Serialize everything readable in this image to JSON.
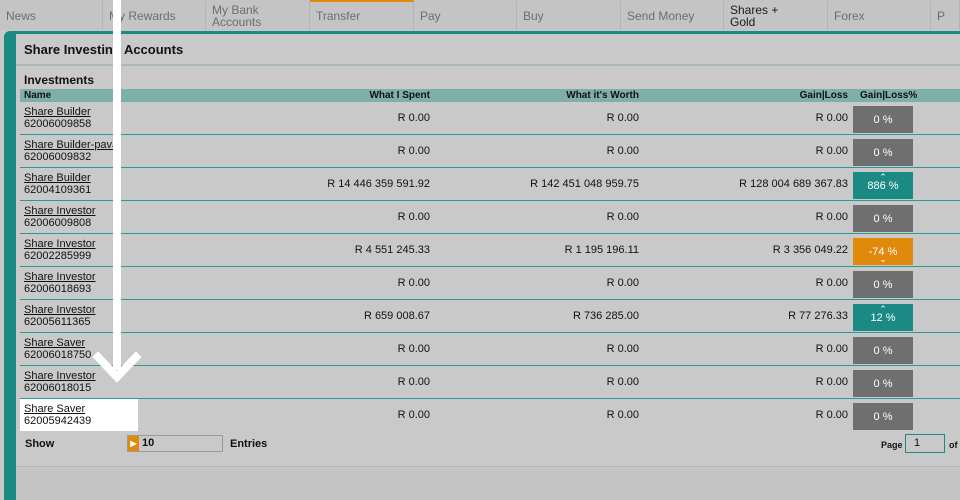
{
  "nav": {
    "items": [
      {
        "label": "News",
        "width": 103,
        "accent": false,
        "active": false
      },
      {
        "label": "My Rewards",
        "width": 103,
        "accent": false,
        "active": false
      },
      {
        "label": "My Bank\nAccounts",
        "width": 104,
        "accent": false,
        "active": false
      },
      {
        "label": "Transfer",
        "width": 104,
        "accent": true,
        "active": false
      },
      {
        "label": "Pay",
        "width": 103,
        "accent": false,
        "active": false
      },
      {
        "label": "Buy",
        "width": 104,
        "accent": false,
        "active": false
      },
      {
        "label": "Send Money",
        "width": 103,
        "accent": false,
        "active": false
      },
      {
        "label": "Shares +\nGold",
        "width": 104,
        "accent": false,
        "active": true
      },
      {
        "label": "Forex",
        "width": 103,
        "accent": false,
        "active": false
      },
      {
        "label": "P",
        "width": 29,
        "accent": false,
        "active": false
      }
    ]
  },
  "panel": {
    "title": "Share Investing Accounts",
    "section": "Investments"
  },
  "table": {
    "headers": {
      "name": "Name",
      "spent": "What I Spent",
      "worth": "What it's Worth",
      "gain": "Gain|Loss",
      "gain_pct": "Gain|Loss%"
    },
    "rows": [
      {
        "name": "Share Builder",
        "number": "62006009858",
        "spent": "R 0.00",
        "worth": "R 0.00",
        "gain": "R 0.00",
        "pct": "0 %",
        "trend": "neutral"
      },
      {
        "name": "Share Builder-pava",
        "number": "62006009832",
        "spent": "R 0.00",
        "worth": "R 0.00",
        "gain": "R 0.00",
        "pct": "0 %",
        "trend": "neutral"
      },
      {
        "name": "Share Builder",
        "number": "62004109361",
        "spent": "R 14 446 359 591.92",
        "worth": "R 142 451 048 959.75",
        "gain": "R 128 004 689 367.83",
        "pct": "886 %",
        "trend": "up"
      },
      {
        "name": "Share Investor",
        "number": "62006009808",
        "spent": "R 0.00",
        "worth": "R 0.00",
        "gain": "R 0.00",
        "pct": "0 %",
        "trend": "neutral"
      },
      {
        "name": "Share Investor",
        "number": "62002285999",
        "spent": "R 4 551 245.33",
        "worth": "R 1 195 196.11",
        "gain": "R 3 356 049.22",
        "pct": "-74 %",
        "trend": "down"
      },
      {
        "name": "Share Investor",
        "number": "62006018693",
        "spent": "R 0.00",
        "worth": "R 0.00",
        "gain": "R 0.00",
        "pct": "0 %",
        "trend": "neutral"
      },
      {
        "name": "Share Investor",
        "number": "62005611365",
        "spent": "R 659 008.67",
        "worth": "R 736 285.00",
        "gain": "R 77 276.33",
        "pct": "12 %",
        "trend": "up"
      },
      {
        "name": "Share Saver",
        "number": "62006018750",
        "spent": "R 0.00",
        "worth": "R 0.00",
        "gain": "R 0.00",
        "pct": "0 %",
        "trend": "neutral"
      },
      {
        "name": "Share Investor",
        "number": "62006018015",
        "spent": "R 0.00",
        "worth": "R 0.00",
        "gain": "R 0.00",
        "pct": "0 %",
        "trend": "neutral"
      },
      {
        "name": "Share Saver",
        "number": "62005942439",
        "spent": "R 0.00",
        "worth": "R 0.00",
        "gain": "R 0.00",
        "pct": "0 %",
        "trend": "neutral",
        "highlighted": true
      }
    ]
  },
  "footer": {
    "show_label": "Show",
    "entries_value": "10",
    "entries_label": "Entries",
    "page_label": "Page",
    "page_value": "1",
    "of_label": "of"
  },
  "icons": {
    "up": "chevron-up-icon",
    "down": "chevron-down-icon",
    "entries": "play-icon",
    "overlay": "arrow-down-icon"
  },
  "colors": {
    "teal": "#1b8a85",
    "orange": "#e08a0b",
    "neutral_badge": "#6f6f6f"
  }
}
